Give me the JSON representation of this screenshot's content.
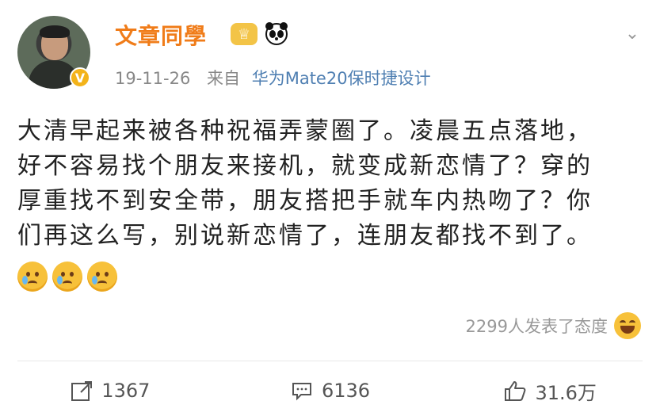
{
  "user": {
    "name": "文章同學",
    "verified_badge": "V",
    "crown_badge": "♕"
  },
  "post": {
    "date": "19-11-26",
    "from_label": "来自",
    "device": "华为Mate20保时捷设计",
    "lines": [
      "大清早起来被各种祝福弄蒙圈了。凌晨五点落地，",
      "好不容易找个朋友来接机，就变成新恋情了？穿的",
      "厚重找不到安全带，朋友搭把手就车内热吻了？你",
      "们再这么写，别说新恋情了，连朋友都找不到了。"
    ],
    "reaction_summary": "2299人发表了态度"
  },
  "actions": {
    "repost": "1367",
    "comment": "6136",
    "like": "31.6万"
  },
  "colors": {
    "name": "#f07c19",
    "device": "#4f7fb2",
    "badge": "#f3b31a"
  }
}
